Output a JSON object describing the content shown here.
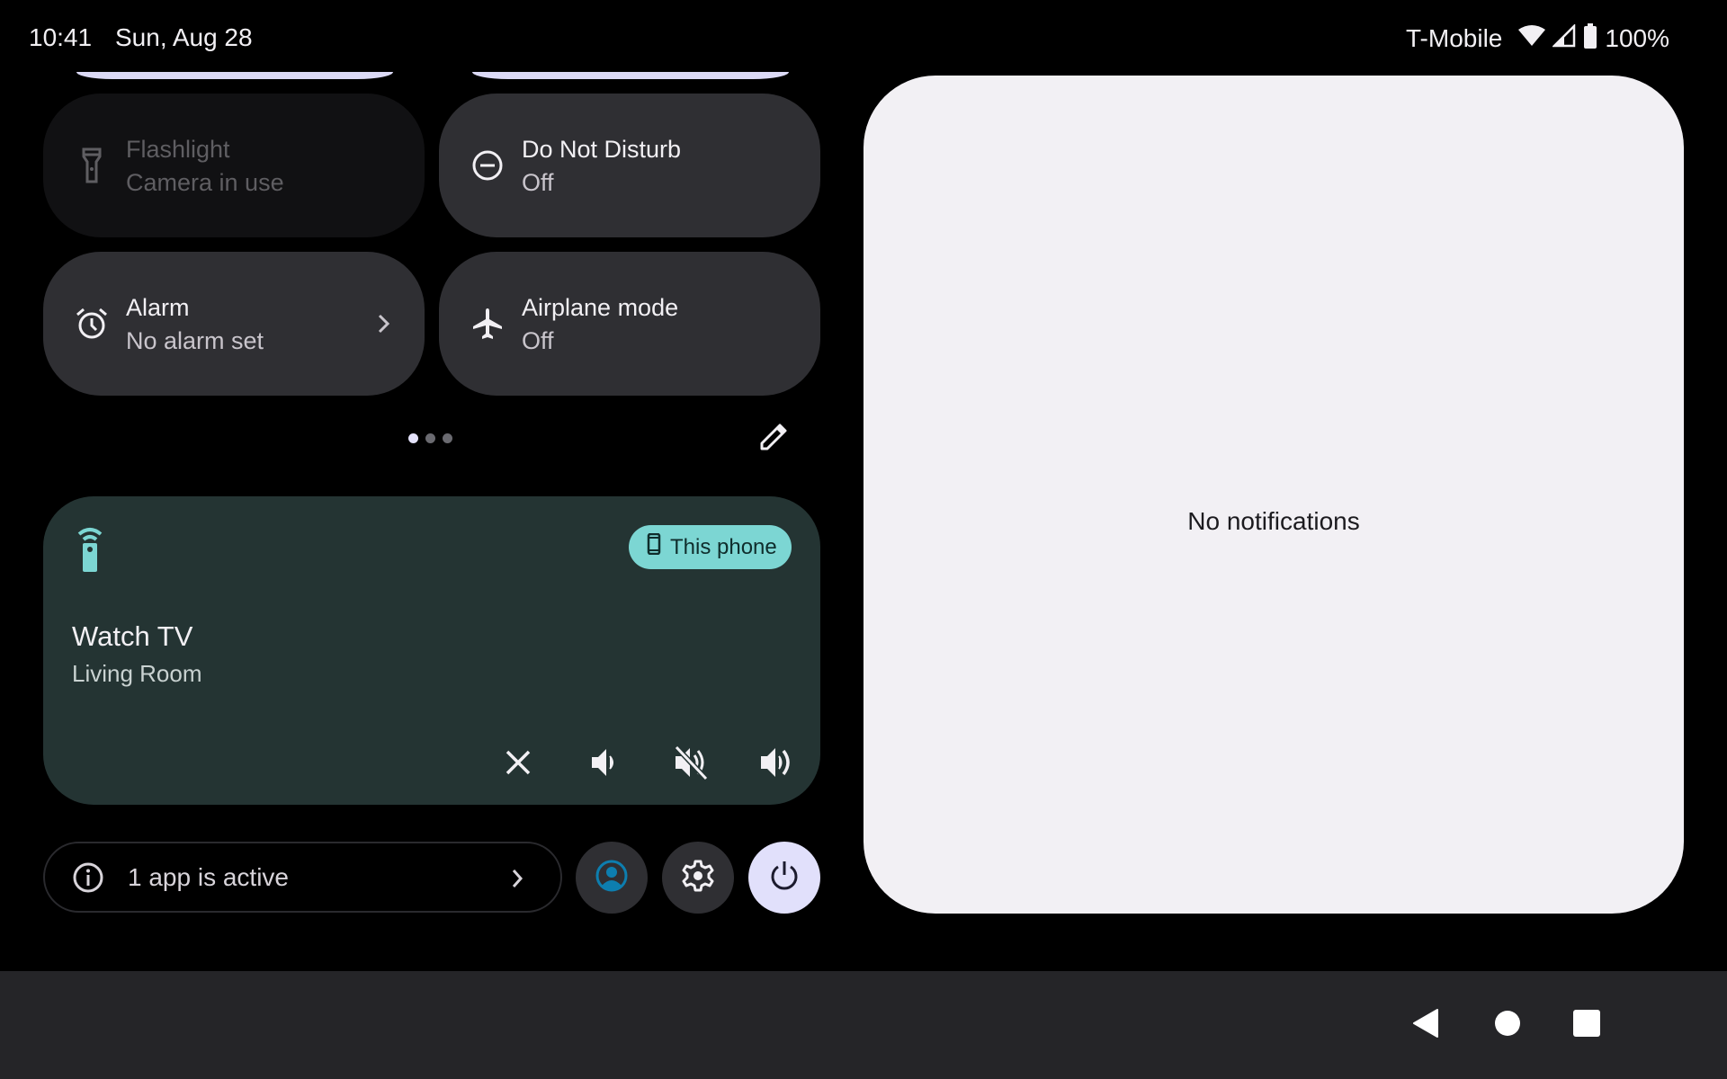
{
  "status_bar": {
    "time": "10:41",
    "date": "Sun, Aug 28",
    "carrier": "T-Mobile",
    "battery_text": "100%",
    "icons": [
      "wifi-icon",
      "cell-signal-icon",
      "battery-icon"
    ]
  },
  "quick_settings": {
    "tiles": [
      {
        "id": "flashlight",
        "title": "Flashlight",
        "subtitle": "Camera in use",
        "icon": "flashlight-icon",
        "state": "unavailable"
      },
      {
        "id": "do-not-disturb",
        "title": "Do Not Disturb",
        "subtitle": "Off",
        "icon": "do-not-disturb-icon",
        "state": "off"
      },
      {
        "id": "alarm",
        "title": "Alarm",
        "subtitle": "No alarm set",
        "icon": "alarm-icon",
        "state": "off",
        "has_chevron": true
      },
      {
        "id": "airplane-mode",
        "title": "Airplane mode",
        "subtitle": "Off",
        "icon": "airplane-icon",
        "state": "off"
      }
    ],
    "page_indicator": {
      "pages": 3,
      "current": 1
    },
    "edit_icon": "pencil-icon"
  },
  "media": {
    "app_icon": "tv-remote-icon",
    "output_chip": {
      "label": "This phone",
      "icon": "phone-icon"
    },
    "title": "Watch TV",
    "subtitle": "Living Room",
    "actions": [
      "close-icon",
      "volume-down-icon",
      "volume-mute-icon",
      "volume-up-icon"
    ],
    "colors": {
      "background": "#243433",
      "accent": "#7cd6d3"
    }
  },
  "footer": {
    "security_text": "1 app is active",
    "buttons": [
      "user-switcher",
      "settings",
      "power"
    ]
  },
  "notifications": {
    "empty_text": "No notifications"
  },
  "nav_bar": {
    "buttons": [
      "back",
      "home",
      "recents"
    ]
  }
}
